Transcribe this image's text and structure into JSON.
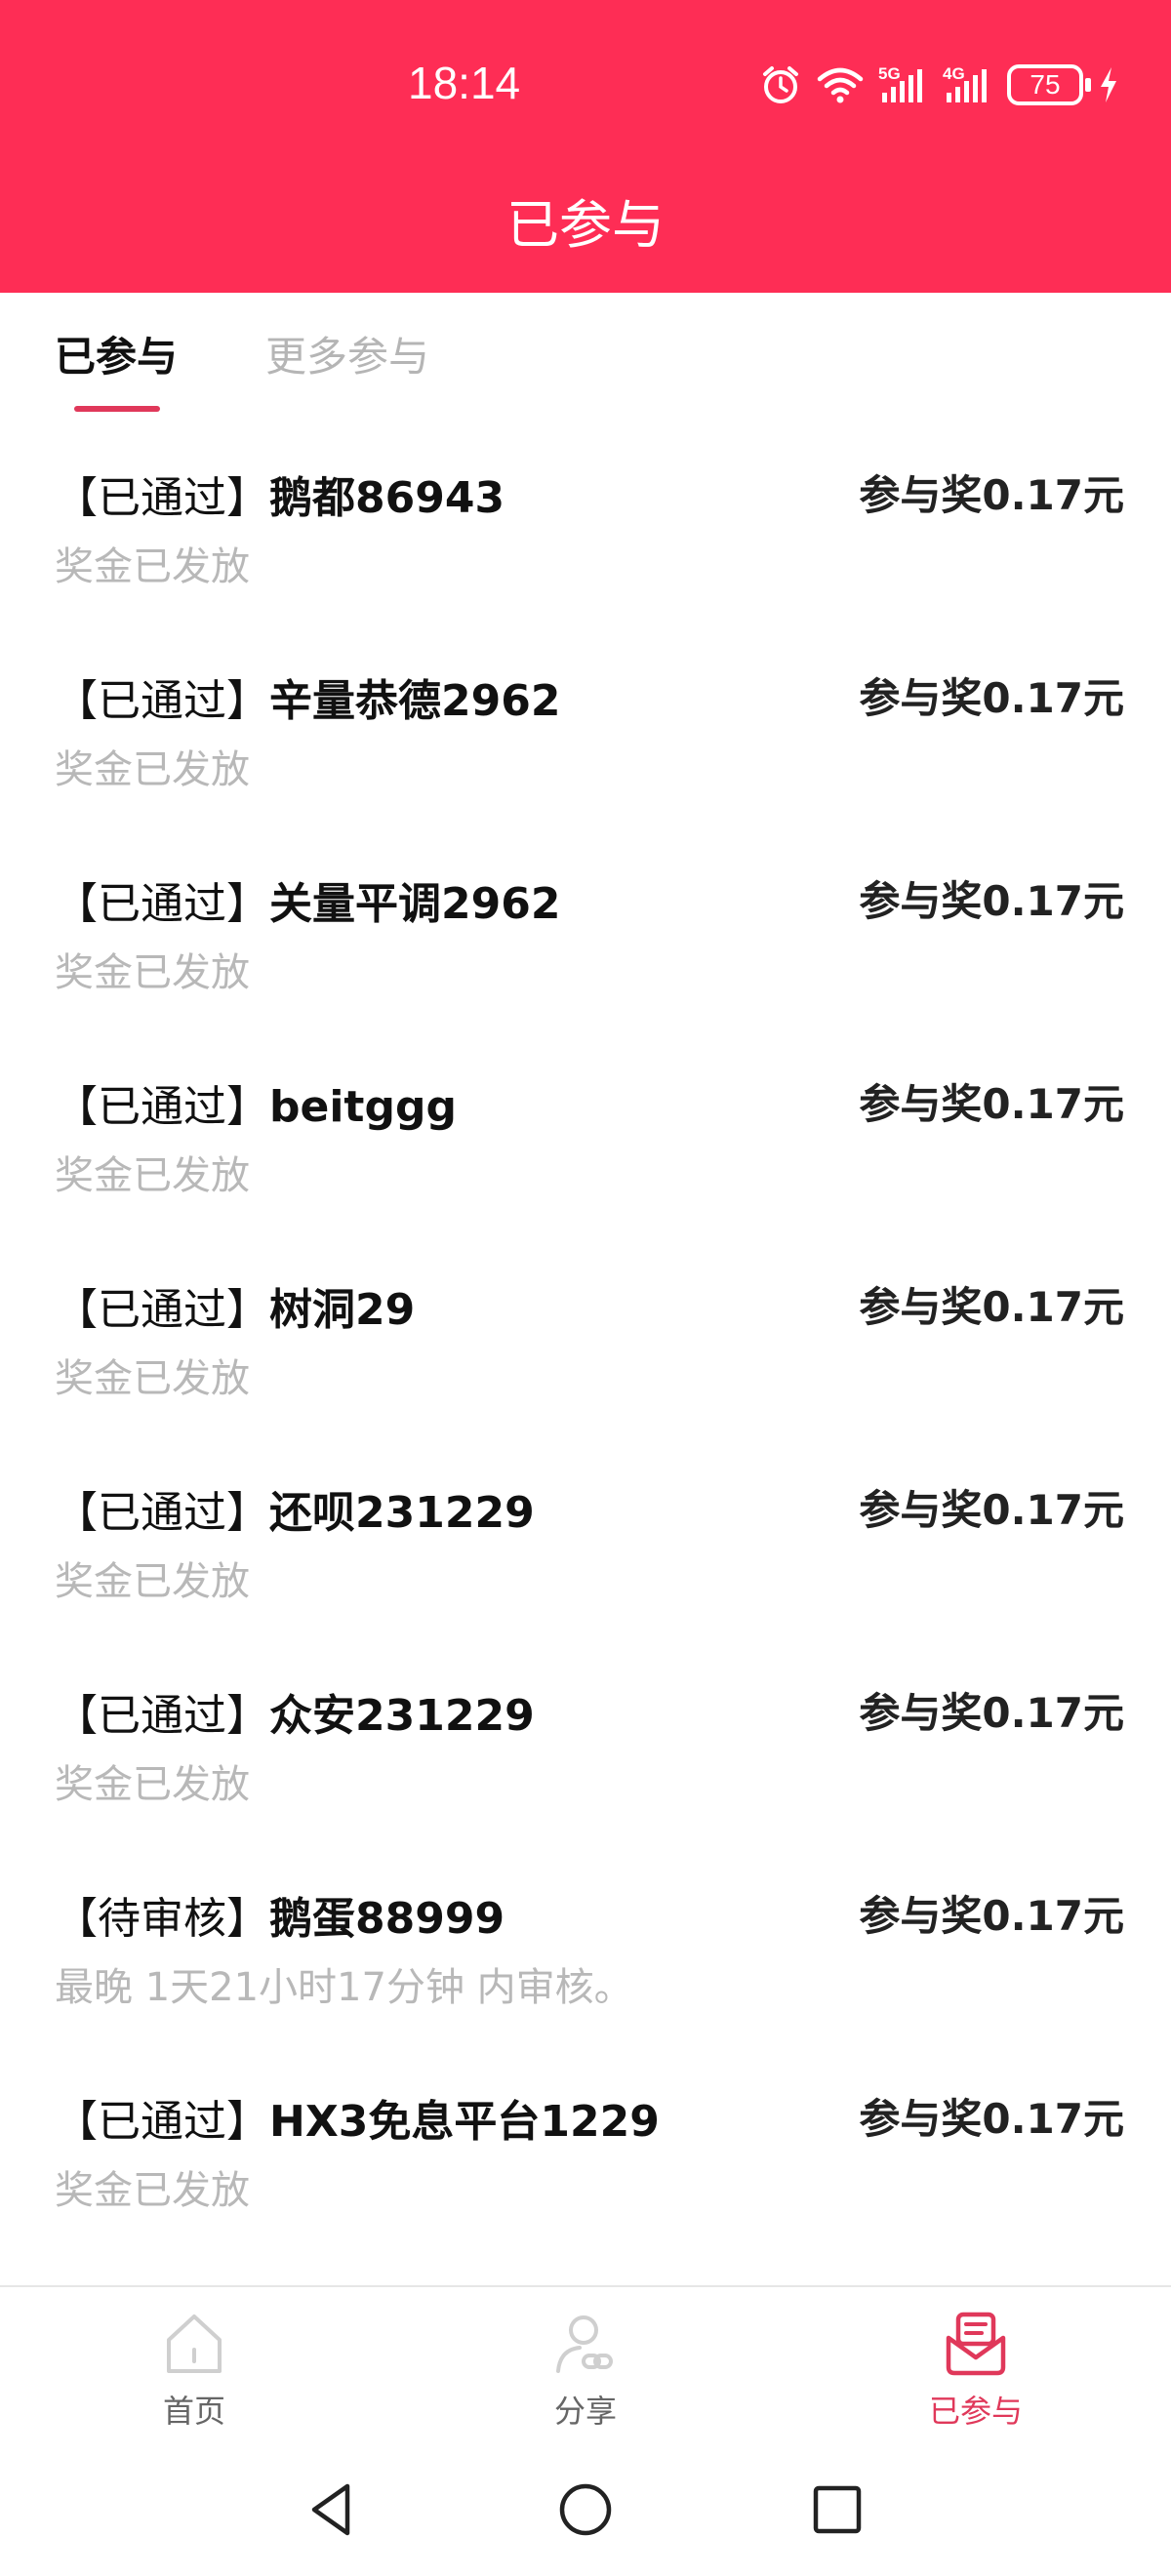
{
  "status_bar": {
    "time": "18:14",
    "signal_1_label": "5G",
    "signal_2_label": "4G",
    "battery": "75",
    "icons": [
      "alarm-icon",
      "wifi-icon",
      "signal-5g-icon",
      "signal-4g-icon",
      "battery-icon",
      "charging-icon"
    ]
  },
  "header": {
    "title": "已参与",
    "background_color": "#fe2d55"
  },
  "tabs": [
    {
      "label": "已参与",
      "active": true
    },
    {
      "label": "更多参与",
      "active": false
    }
  ],
  "items": [
    {
      "status": "【已通过】",
      "name": "鹅都86943",
      "reward": "参与奖0.17元",
      "sub": "奖金已发放"
    },
    {
      "status": "【已通过】",
      "name": "辛量恭德2962",
      "reward": "参与奖0.17元",
      "sub": "奖金已发放"
    },
    {
      "status": "【已通过】",
      "name": "关量平调2962",
      "reward": "参与奖0.17元",
      "sub": "奖金已发放"
    },
    {
      "status": "【已通过】",
      "name": "beitggg",
      "reward": "参与奖0.17元",
      "sub": "奖金已发放"
    },
    {
      "status": "【已通过】",
      "name": "树洞29",
      "reward": "参与奖0.17元",
      "sub": "奖金已发放"
    },
    {
      "status": "【已通过】",
      "name": "还呗231229",
      "reward": "参与奖0.17元",
      "sub": "奖金已发放"
    },
    {
      "status": "【已通过】",
      "name": "众安231229",
      "reward": "参与奖0.17元",
      "sub": "奖金已发放"
    },
    {
      "status": "【待审核】",
      "name": "鹅蛋88999",
      "reward": "参与奖0.17元",
      "sub": "最晚 1天21小时17分钟 内审核。"
    },
    {
      "status": "【已通过】",
      "name": "HX3免息平台1229",
      "reward": "参与奖0.17元",
      "sub": "奖金已发放"
    }
  ],
  "bottom_nav": {
    "home": {
      "label": "首页",
      "icon": "home-icon"
    },
    "share": {
      "label": "分享",
      "icon": "user-link-icon"
    },
    "joined": {
      "label": "已参与",
      "icon": "envelope-icon",
      "active": true,
      "color": "#e0385a"
    }
  },
  "system_nav": {
    "icons": [
      "back-icon",
      "home-circle-icon",
      "recents-icon"
    ]
  }
}
